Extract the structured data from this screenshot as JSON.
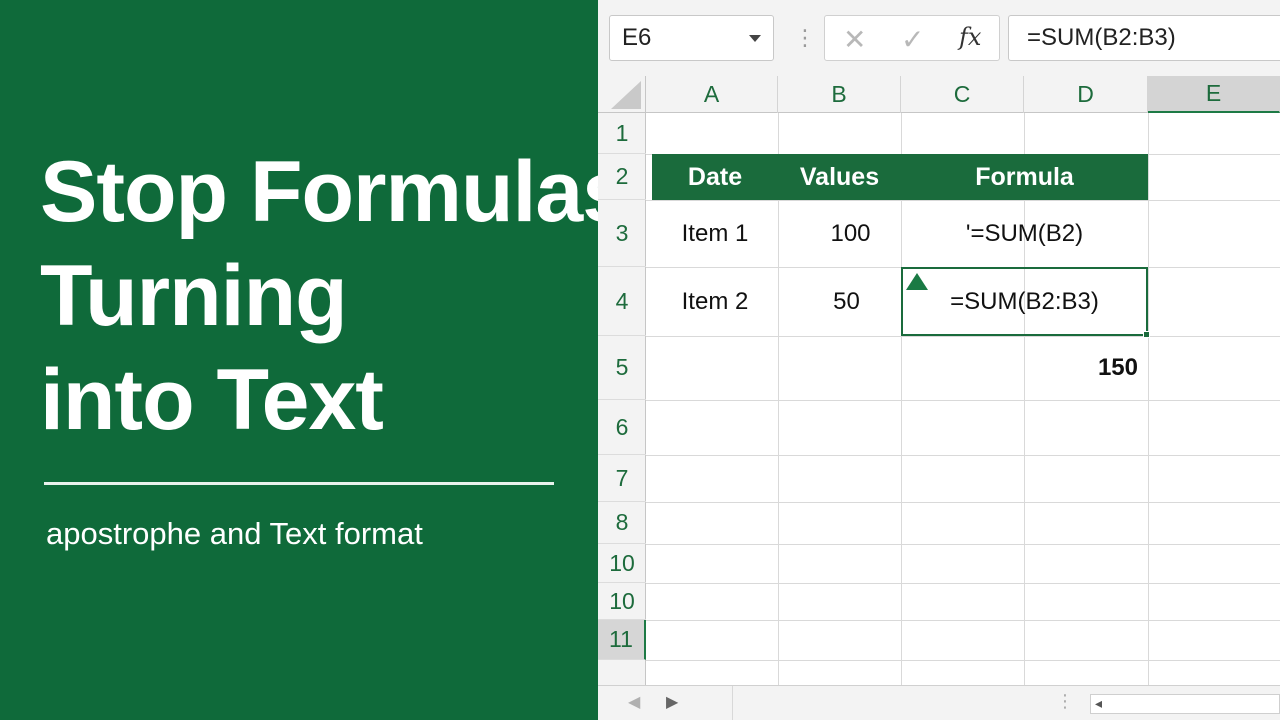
{
  "promo": {
    "title_lines": [
      "Stop Formulas",
      "Turning",
      "into Text"
    ],
    "subtitle": "apostrophe and Text format",
    "background": "#0f6a3a"
  },
  "formula_bar": {
    "name_box": "E6",
    "separator": "⋮",
    "cancel_icon": "✕",
    "enter_icon": "✓",
    "fx_icon": "fx",
    "formula": "=SUM(B2:B3)"
  },
  "columns": [
    "A",
    "B",
    "C",
    "D",
    "E"
  ],
  "active_column": "E",
  "rows": [
    "1",
    "2",
    "3",
    "4",
    "5",
    "6",
    "7",
    "8",
    "10",
    "10",
    "11"
  ],
  "active_row": "11",
  "table": {
    "headers": [
      "Date",
      "Values",
      "Formula"
    ],
    "rows": [
      {
        "label": "Item 1",
        "value": "100",
        "formula": "'=SUM(B2)"
      },
      {
        "label": "Item 2",
        "value": "50",
        "formula": "=SUM(B2:B3)"
      }
    ],
    "total": "150"
  },
  "bottom_bar": {
    "prev": "◀",
    "next": "▶",
    "dots": "⋮",
    "scroll_left": "◂"
  },
  "colors": {
    "accent_green": "#1a6b3c",
    "header_text": "#1d6b3c"
  }
}
